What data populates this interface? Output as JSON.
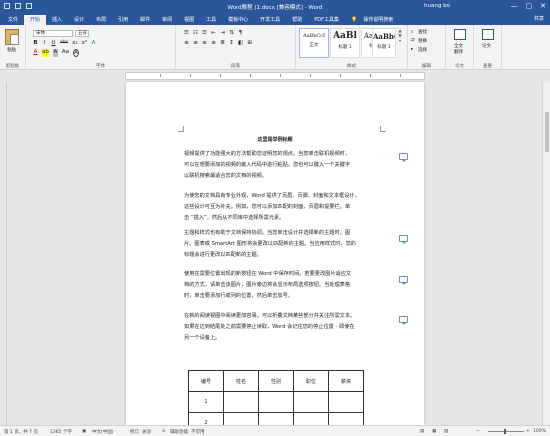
{
  "window": {
    "title": "Word教程 (1.docx [兼容模式] - Word",
    "user": "huang bo",
    "minimize": "—",
    "restore": "▢",
    "close": "✕"
  },
  "tabs": [
    "文件",
    "开始",
    "插入",
    "设计",
    "布局",
    "引用",
    "邮件",
    "审阅",
    "视图",
    "工具",
    "模板中心",
    "开发工具",
    "帮助",
    "PDF工具集"
  ],
  "active_tab": "开始",
  "tell_me": "操作说明搜索",
  "share": "共享",
  "ribbon": {
    "clipboard": {
      "paste": "粘贴",
      "label": "剪贴板"
    },
    "font": {
      "name": "宋体",
      "size": "五号",
      "label": "字体",
      "row2": [
        "B",
        "I",
        "U",
        "abc",
        "x₂",
        "x²",
        "A"
      ],
      "row3": [
        "A",
        "ab",
        "A",
        "Aa",
        "A"
      ]
    },
    "paragraph": {
      "label": "段落",
      "row2": [
        "≡",
        "≡",
        "≡",
        "≡",
        "≣"
      ]
    },
    "styles": {
      "label": "样式",
      "items": [
        {
          "preview": "AaBbCcI",
          "name": "正文"
        },
        {
          "preview": "AaBl",
          "name": "标题 1"
        },
        {
          "preview": "AaBbC",
          "name": "标题 2"
        },
        {
          "preview": "AaBb(",
          "name": "标题 3"
        }
      ]
    },
    "editing": {
      "find": "查找",
      "replace": "替换",
      "select": "选择",
      "label": "编辑"
    },
    "fullsearch": {
      "label1": "全文",
      "label2": "翻译",
      "group": "论文"
    },
    "paper": {
      "label": "论文",
      "group": "查重"
    }
  },
  "document": {
    "title": "这里是举例标题",
    "paragraphs": [
      [
        "视频提供了功能强大的方法帮助您证明您的观点。当您单击联机视频时，",
        "可以在想要添加的视频的嵌入代码中进行粘贴。您也可以键入一个关键字",
        "以联机搜索最适合您的文档的视频。"
      ],
      [
        "为使您的文档具有专业外观，Word 提供了页眉、页脚、封面和文本框设计，",
        "这些设计可互为补充。例如，您可以添加匹配的封面、页眉和提要栏。单",
        "击 “插入”，然后从不同库中选择所需元素。"
      ],
      [
        "主题和样式也有助于文档保持协调。当您单击设计并选择新的主题时，图",
        "片、图表或 SmartArt 图形将会更改以匹配新的主题。当应用样式时，您的",
        "标题会进行更改以匹配新的主题。"
      ],
      [
        "使用在需要位置出现的新按钮在 Word 中保存时间。若要更改图片适应文",
        "档的方式，请单击该图片，图片旁边将会显示布局选项按钮。当处理表格",
        "时，单击要添加行或列的位置，然后单击加号。"
      ],
      [
        "在新的阅读视图中阅读更加容易。可以折叠文档某些部分并关注所需文本。",
        "如果在达到结尾处之前需要停止读取，Word 会记住您的停止位置 - 即使在",
        "另一个设备上。"
      ]
    ],
    "table": {
      "headers": [
        "编号",
        "姓名",
        "性别",
        "职位",
        "薪资"
      ],
      "rows": [
        [
          "1",
          "",
          "",
          "",
          ""
        ],
        [
          "2",
          "",
          "",
          "",
          ""
        ]
      ]
    }
  },
  "status": {
    "page": "第 1 页，共 7 页",
    "words": "1365 个字",
    "lang_icon": "中文(中国)",
    "track": "修订: 关闭",
    "accessibility": "辅助功能: 不可用",
    "zoom": "100%"
  }
}
